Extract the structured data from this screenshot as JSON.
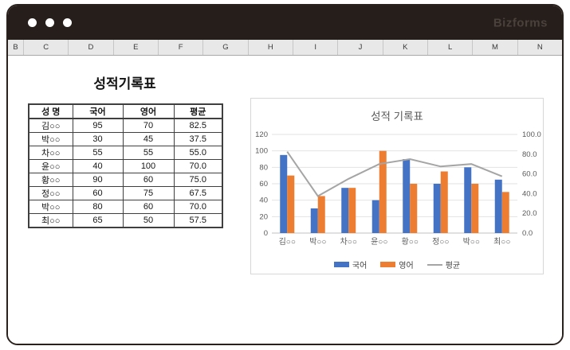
{
  "window": {
    "brand": "Bizforms",
    "controls": [
      "dot",
      "dot",
      "dot"
    ]
  },
  "spreadsheet": {
    "column_headers": [
      "B",
      "C",
      "D",
      "E",
      "F",
      "G",
      "H",
      "I",
      "J",
      "K",
      "L",
      "M",
      "N"
    ]
  },
  "sheet": {
    "title": "성적기록표",
    "table": {
      "headers": [
        "성 명",
        "국어",
        "영어",
        "평균"
      ],
      "rows": [
        [
          "김○○",
          "95",
          "70",
          "82.5"
        ],
        [
          "박○○",
          "30",
          "45",
          "37.5"
        ],
        [
          "차○○",
          "55",
          "55",
          "55.0"
        ],
        [
          "윤○○",
          "40",
          "100",
          "70.0"
        ],
        [
          "황○○",
          "90",
          "60",
          "75.0"
        ],
        [
          "정○○",
          "60",
          "75",
          "67.5"
        ],
        [
          "박○○",
          "80",
          "60",
          "70.0"
        ],
        [
          "최○○",
          "65",
          "50",
          "57.5"
        ]
      ]
    }
  },
  "chart_data": {
    "type": "combo",
    "title": "성적 기록표",
    "categories": [
      "김○○",
      "박○○",
      "차○○",
      "윤○○",
      "황○○",
      "정○○",
      "박○○",
      "최○○"
    ],
    "series": [
      {
        "name": "국어",
        "type": "bar",
        "axis": "left",
        "color": "#4472C4",
        "values": [
          95,
          30,
          55,
          40,
          90,
          60,
          80,
          65
        ]
      },
      {
        "name": "영어",
        "type": "bar",
        "axis": "left",
        "color": "#ED7D31",
        "values": [
          70,
          45,
          55,
          100,
          60,
          75,
          60,
          50
        ]
      },
      {
        "name": "평균",
        "type": "line",
        "axis": "right",
        "color": "#A5A5A5",
        "values": [
          82.5,
          37.5,
          55.0,
          70.0,
          75.0,
          67.5,
          70.0,
          57.5
        ]
      }
    ],
    "left_axis": {
      "min": 0,
      "max": 120,
      "ticks": [
        0,
        20,
        40,
        60,
        80,
        100,
        120
      ]
    },
    "right_axis": {
      "min": 0,
      "max": 100,
      "tick_labels": [
        "0.0",
        "20.0",
        "40.0",
        "60.0",
        "80.0",
        "100.0"
      ]
    },
    "legend_position": "bottom",
    "grid": true,
    "colors": {
      "gridline": "#e2e2e2",
      "axis_line": "#c0c0c0",
      "axis_text": "#595959"
    }
  }
}
